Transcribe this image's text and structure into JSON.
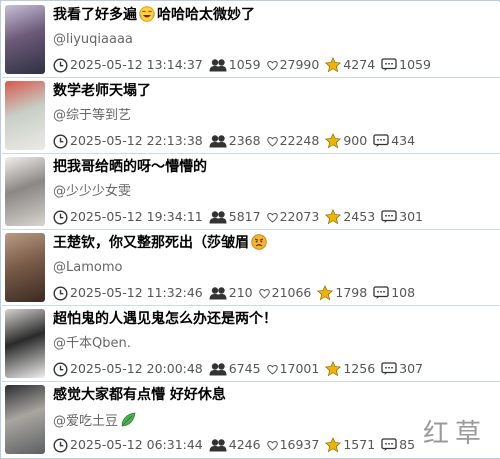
{
  "posts": [
    {
      "title": "我看了好多遍",
      "title_suffix": "哈哈哈太微妙了",
      "emoji": "crying-laughing-emoji",
      "author": "@liyuqiaaaa",
      "timestamp": "2025-05-12 13:14:37",
      "followers": "1059",
      "likes": "27990",
      "stars": "4274",
      "comments": "1059",
      "thumb_colors": [
        "#2e3140",
        "#6d5a7a",
        "#c6c0d8"
      ]
    },
    {
      "title": "数学老师天塌了",
      "title_suffix": "",
      "emoji": "",
      "author": "@综于等到艺",
      "timestamp": "2025-05-12 22:13:38",
      "followers": "2368",
      "likes": "22248",
      "stars": "900",
      "comments": "434",
      "thumb_colors": [
        "#eceae4",
        "#c7cfc6",
        "#d9584f"
      ]
    },
    {
      "title": "把我哥给晒的呀～懵懵的",
      "title_suffix": "",
      "emoji": "",
      "author": "@少少少女雯",
      "timestamp": "2025-05-12 19:34:11",
      "followers": "5817",
      "likes": "22073",
      "stars": "2453",
      "comments": "301",
      "thumb_colors": [
        "#d8d4d0",
        "#8a8784",
        "#f2efec"
      ]
    },
    {
      "title": "王楚钦，你又整那死出（莎皱眉",
      "title_suffix": "",
      "emoji": "angry-face-emoji",
      "author": "@Lamomo",
      "timestamp": "2025-05-12 11:32:46",
      "followers": "210",
      "likes": "21066",
      "stars": "1798",
      "comments": "108",
      "thumb_colors": [
        "#3a2a22",
        "#7a5c48",
        "#b89c84"
      ]
    },
    {
      "title": "超怕鬼的人遇见鬼怎么办还是两个！",
      "title_suffix": "",
      "emoji": "",
      "author": "@千本Qben.",
      "timestamp": "2025-05-12 20:00:48",
      "followers": "6745",
      "likes": "17001",
      "stars": "1256",
      "comments": "307",
      "thumb_colors": [
        "#f0efee",
        "#2a2a2a",
        "#d4d2d0"
      ]
    },
    {
      "title": "感觉大家都有点懵 好好休息",
      "title_suffix": "",
      "emoji": "",
      "author": "@爱吃土豆",
      "author_emoji": "leaf-emoji",
      "timestamp": "2025-05-12 06:31:44",
      "followers": "4246",
      "likes": "16937",
      "stars": "1571",
      "comments": "85",
      "thumb_colors": [
        "#5c5f63",
        "#a9a6a0",
        "#2b2d31"
      ]
    }
  ],
  "icons": {
    "clock": "clock-icon",
    "followers": "people-icon",
    "likes": "heart-icon",
    "stars": "star-icon",
    "comments": "comment-icon"
  },
  "colors": {
    "star": "#f0b400",
    "people": "#333333",
    "border": "#cdd9e6"
  },
  "watermark": "红草"
}
